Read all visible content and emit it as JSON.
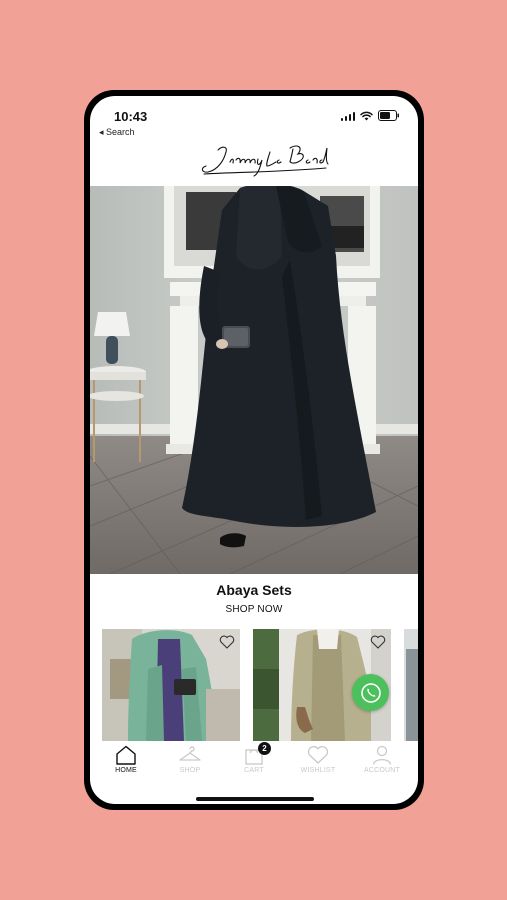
{
  "status_bar": {
    "time": "10:43",
    "back_label": "◂ Search"
  },
  "brand": {
    "logo_alt": "Jimmy le Bond"
  },
  "collection": {
    "title": "Abaya Sets",
    "cta": "SHOP NOW"
  },
  "tabs": [
    {
      "label": "HOME",
      "icon": "home-icon",
      "active": true
    },
    {
      "label": "SHOP",
      "icon": "hanger-icon",
      "active": false
    },
    {
      "label": "CART",
      "icon": "shopping-bag-icon",
      "active": false,
      "badge": "2"
    },
    {
      "label": "WISHLIST",
      "icon": "heart-icon",
      "active": false
    },
    {
      "label": "ACCOUNT",
      "icon": "user-icon",
      "active": false
    }
  ],
  "colors": {
    "background": "#F1A195",
    "whatsapp": "#4CC05C",
    "active_tab": "#111111",
    "inactive_tab": "#C9C9C9"
  }
}
